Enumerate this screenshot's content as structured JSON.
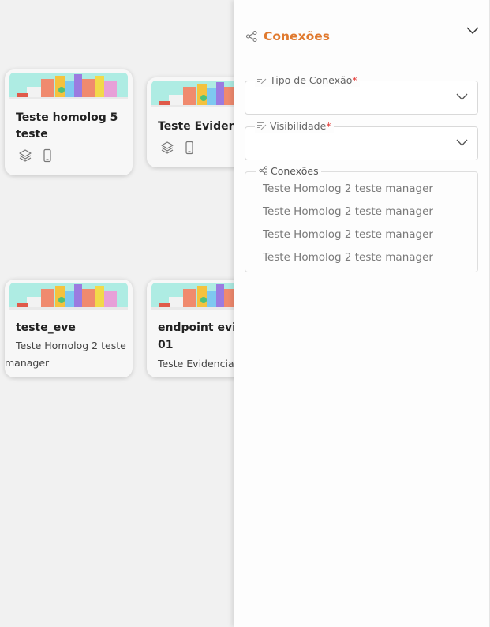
{
  "cards_top": [
    {
      "title_line1": "Teste homolog 5",
      "title_line2": "teste",
      "icons": [
        "layers-icon",
        "mobile-device-icon"
      ]
    },
    {
      "title_line1": "Teste Evidenc",
      "icons": [
        "layers-icon",
        "mobile-device-icon"
      ]
    }
  ],
  "cards_bottom": [
    {
      "title_line1": "teste_eve",
      "subtitle_line1": "Teste Homolog 2 teste",
      "subtitle_line2": "manager"
    },
    {
      "title_line1": "endpoint evic",
      "title_line2": "01",
      "subtitle_line1": "Teste Evidencia"
    }
  ],
  "panel": {
    "title": "Conexões",
    "header_icon": "share-icon",
    "collapse_icon": "chevron-down-icon",
    "accent_color": "#e07a2f",
    "fields": [
      {
        "label": "Tipo de Conexão",
        "required_mark": "*",
        "value": ""
      },
      {
        "label": "Visibilidade",
        "required_mark": "*",
        "value": ""
      }
    ],
    "connections": {
      "label": "Conexões",
      "items": [
        "Teste Homolog 2 teste manager",
        "Teste Homolog 2 teste manager",
        "Teste Homolog 2 teste manager",
        "Teste Homolog 2 teste manager"
      ]
    }
  }
}
